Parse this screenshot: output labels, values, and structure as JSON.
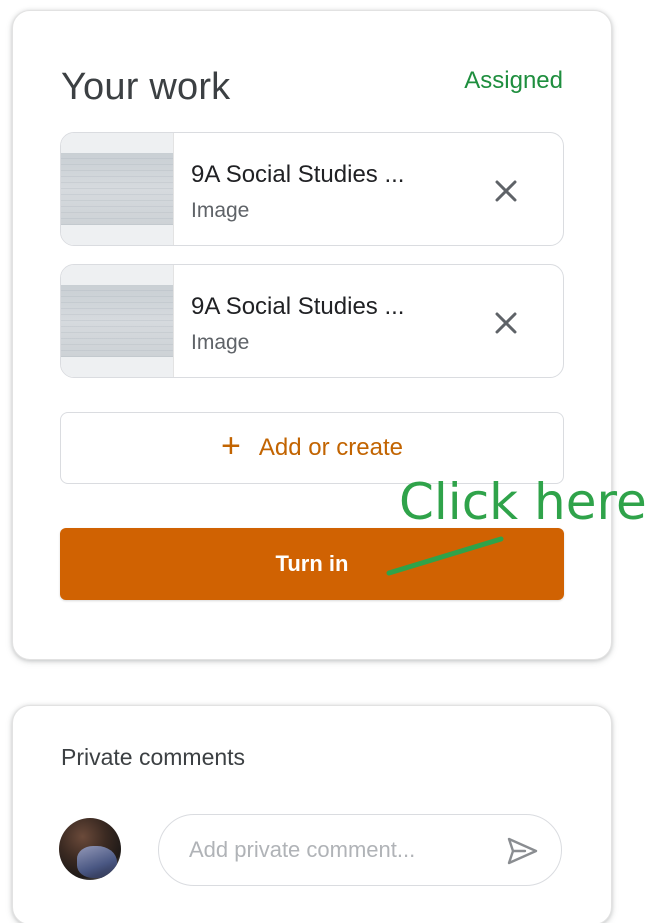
{
  "work": {
    "title": "Your work",
    "status": "Assigned",
    "attachments": [
      {
        "title": "9A Social Studies ...",
        "type": "Image",
        "remove_icon": "close-icon"
      },
      {
        "title": "9A Social Studies ...",
        "type": "Image",
        "remove_icon": "close-icon"
      }
    ],
    "add_label": "Add or create",
    "add_icon": "plus-icon",
    "turn_in_label": "Turn in",
    "annotation": "Click here"
  },
  "comments": {
    "title": "Private comments",
    "placeholder": "Add private comment...",
    "send_icon": "send-icon"
  },
  "colors": {
    "accent": "#d06202",
    "status": "#1e8e3e",
    "annotation": "#2fa34a",
    "text": "#3c4043"
  }
}
